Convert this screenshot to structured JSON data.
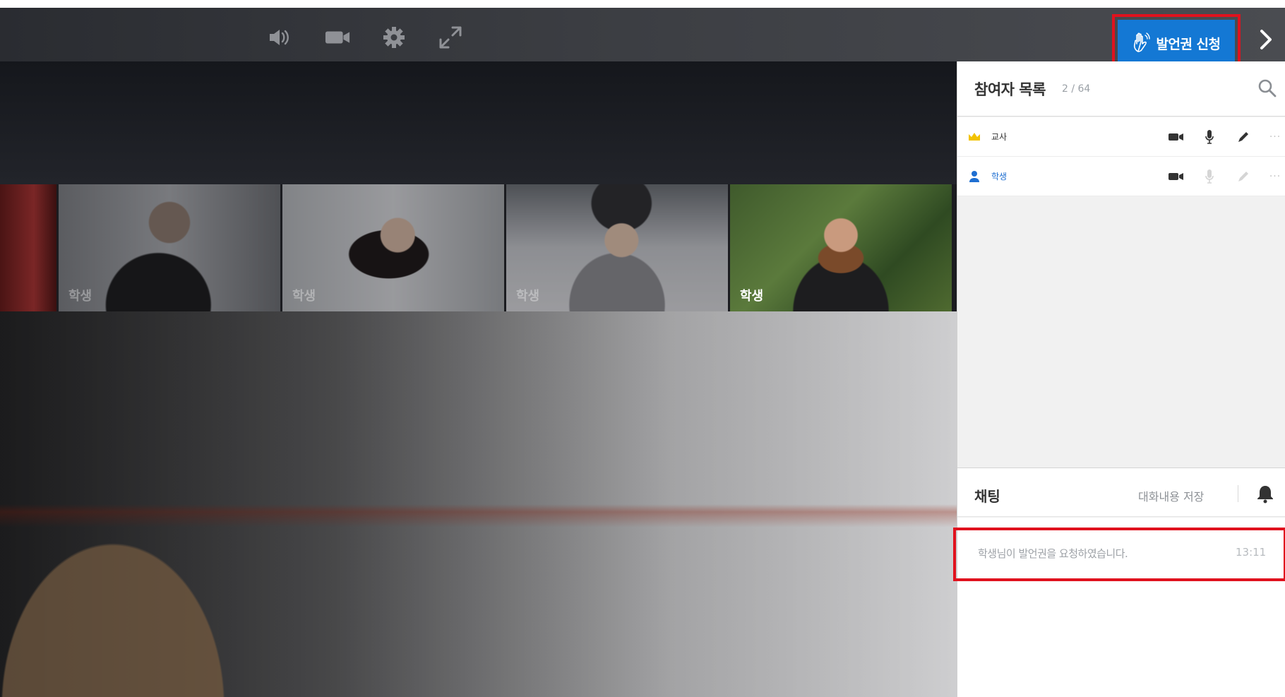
{
  "toolbar": {
    "icons": [
      "speaker-icon",
      "video-camera-icon",
      "gear-icon",
      "fullscreen-icon"
    ],
    "request_button_label": "발언권 신청",
    "request_button_color": "#1478d4",
    "highlight_color": "#e0121e"
  },
  "thumbnails": [
    {
      "name": ""
    },
    {
      "name": "학생"
    },
    {
      "name": "학생"
    },
    {
      "name": "학생"
    },
    {
      "name": "학생"
    }
  ],
  "participants": {
    "title": "참여자 목록",
    "count": "2 / 64",
    "rows": [
      {
        "name": "교사",
        "role_icon": "crown-icon"
      },
      {
        "name": "학생",
        "role_icon": "person-icon"
      }
    ]
  },
  "chat": {
    "title": "채팅",
    "save_label": "대화내용 저장",
    "messages": [
      {
        "text": "학생님이 발언권을 요청하였습니다.",
        "time": "13:11"
      }
    ]
  }
}
